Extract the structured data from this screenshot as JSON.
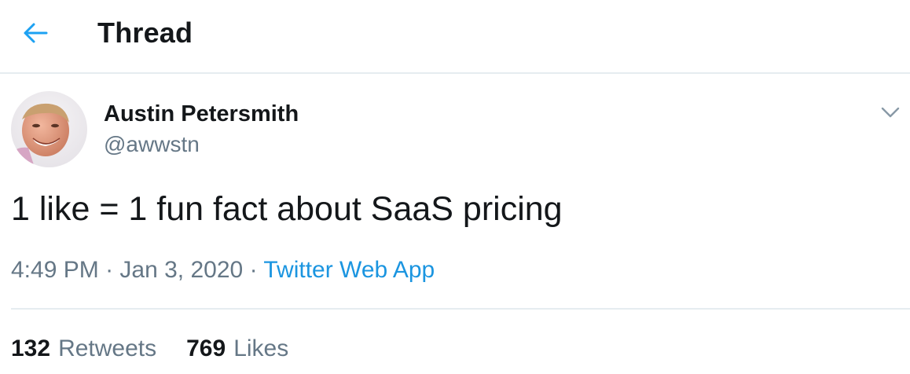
{
  "header": {
    "title": "Thread",
    "back_icon": "arrow-left-icon",
    "accent_color": "#1da1f2"
  },
  "tweet": {
    "author": {
      "name": "Austin Petersmith",
      "handle": "@awwstn",
      "avatar_icon": "user-avatar"
    },
    "more_icon": "chevron-down-icon",
    "text": "1 like = 1 fun fact about SaaS pricing",
    "meta": {
      "time": "4:49 PM",
      "separator": "·",
      "date": "Jan 3, 2020",
      "source": "Twitter Web App"
    },
    "stats": {
      "retweets_count": "132",
      "retweets_label": "Retweets",
      "likes_count": "769",
      "likes_label": "Likes"
    }
  },
  "colors": {
    "text": "#14171a",
    "secondary_text": "#657786",
    "link": "#1b95e0",
    "divider": "#e6ecf0"
  }
}
